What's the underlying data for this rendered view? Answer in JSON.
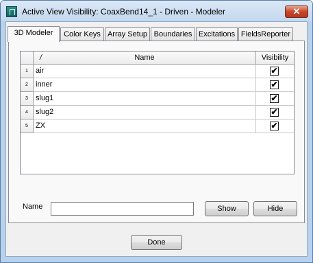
{
  "window": {
    "title": "Active View Visibility: CoaxBend14_1 - Driven - Modeler",
    "close_glyph": "✕"
  },
  "tabs": [
    {
      "label": "3D Modeler",
      "active": true
    },
    {
      "label": "Color Keys",
      "active": false
    },
    {
      "label": "Array Setup",
      "active": false
    },
    {
      "label": "Boundaries",
      "active": false
    },
    {
      "label": "Excitations",
      "active": false
    },
    {
      "label": "FieldsReporter",
      "active": false
    }
  ],
  "grid": {
    "sort_glyph": "/",
    "columns": [
      "Name",
      "Visibility"
    ],
    "rows": [
      {
        "num": "1",
        "name": "air",
        "visible": true,
        "mark": "✔"
      },
      {
        "num": "2",
        "name": "inner",
        "visible": true,
        "mark": "✔"
      },
      {
        "num": "3",
        "name": "slug1",
        "visible": true,
        "mark": "✔"
      },
      {
        "num": "4",
        "name": "slug2",
        "visible": true,
        "mark": "✔"
      },
      {
        "num": "5",
        "name": "ZX",
        "visible": true,
        "mark": "✔"
      }
    ]
  },
  "filter": {
    "label": "Name",
    "value": "",
    "show_label": "Show",
    "hide_label": "Hide"
  },
  "footer": {
    "done_label": "Done"
  }
}
